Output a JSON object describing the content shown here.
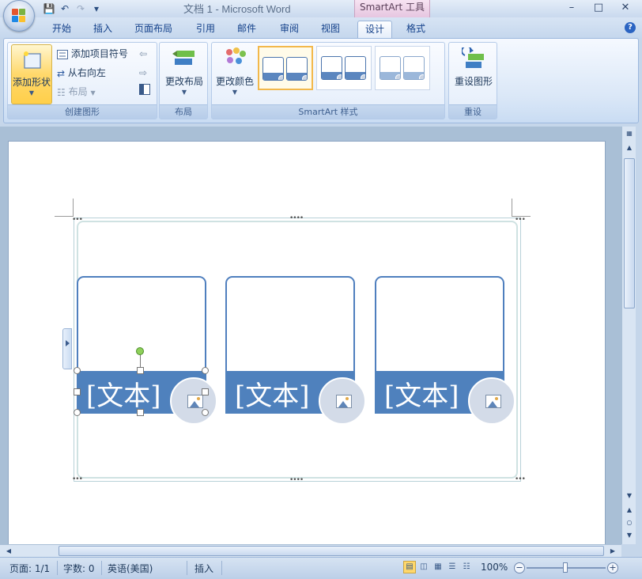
{
  "window": {
    "title": "文档 1 - Microsoft Word",
    "contextual_tab_group": "SmartArt 工具",
    "controls": [
      "–",
      "□",
      "✕"
    ]
  },
  "quick_access": [
    "save-icon",
    "undo-icon",
    "redo-icon",
    "customize-icon"
  ],
  "tabs": [
    {
      "label": "开始"
    },
    {
      "label": "插入"
    },
    {
      "label": "页面布局"
    },
    {
      "label": "引用"
    },
    {
      "label": "邮件"
    },
    {
      "label": "审阅"
    },
    {
      "label": "视图"
    },
    {
      "label": "设计",
      "active": true
    },
    {
      "label": "格式"
    }
  ],
  "ribbon": {
    "create_graphic": {
      "label": "创建图形",
      "add_shape": "添加形状",
      "add_bullet": "添加项目符号",
      "right_to_left": "从右向左",
      "layout": "布局"
    },
    "layouts": {
      "label": "布局",
      "change_layout": "更改布局"
    },
    "styles": {
      "label": "SmartArt 样式",
      "change_colors": "更改颜色"
    },
    "reset": {
      "label": "重设",
      "reset_graphic": "重设图形"
    }
  },
  "document": {
    "cards": [
      {
        "text": "[文本]"
      },
      {
        "text": "[文本]"
      },
      {
        "text": "[文本]"
      }
    ]
  },
  "statusbar": {
    "page": "页面: 1/1",
    "words": "字数: 0",
    "language": "英语(美国)",
    "mode": "插入",
    "zoom": "100%"
  },
  "colors": {
    "card_fill": "#4f81bd",
    "card_border": "#4f7fbe",
    "ribbon_bg": "#dae7f7",
    "selected_style": "#f2b84b"
  }
}
